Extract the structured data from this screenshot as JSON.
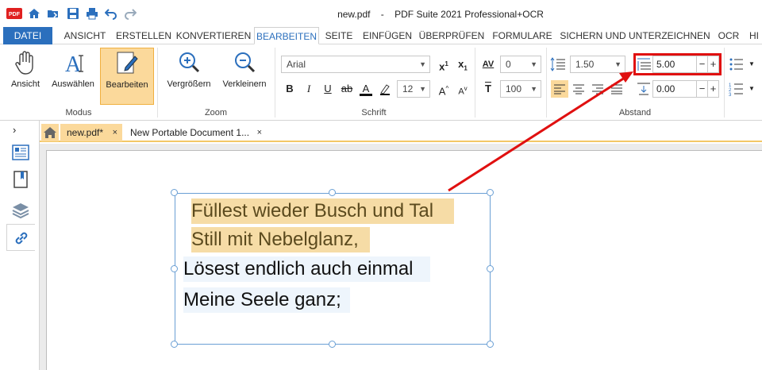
{
  "title": {
    "file": "new.pdf",
    "separator": "-",
    "app": "PDF Suite 2021  Professional+OCR"
  },
  "quick_access": [
    "pdf-logo-icon",
    "home-icon",
    "open-folder-icon",
    "save-icon",
    "print-icon",
    "undo-icon",
    "redo-icon"
  ],
  "menu": {
    "tabs": [
      "DATEI",
      "ANSICHT",
      "ERSTELLEN",
      "KONVERTIEREN",
      "BEARBEITEN",
      "SEITE",
      "EINFÜGEN",
      "ÜBERPRÜFEN",
      "FORMULARE",
      "SICHERN UND UNTERZEICHNEN",
      "OCR",
      "HI"
    ],
    "active": "BEARBEITEN"
  },
  "ribbon": {
    "modus": {
      "label": "Modus",
      "buttons": [
        "Ansicht",
        "Auswählen",
        "Bearbeiten"
      ]
    },
    "zoom": {
      "label": "Zoom",
      "buttons": [
        "Vergrößern",
        "Verkleinern"
      ]
    },
    "schrift": {
      "label": "Schrift",
      "font_name": "Arial",
      "font_size": "12",
      "char_spacing": "0",
      "char_scale": "100",
      "grow": "A",
      "shrink": "A"
    },
    "abstand": {
      "label": "Abstand",
      "line_spacing": "1.50",
      "paragraph_spacing": "5.00",
      "indent_value": "0.00"
    }
  },
  "doc_tabs": [
    {
      "label": "new.pdf*",
      "close": "×"
    },
    {
      "label": "New Portable Document 1...",
      "close": "×"
    }
  ],
  "document": {
    "lines": [
      "Füllest wieder Busch und Tal",
      "Still mit Nebelglanz,",
      "Lösest endlich auch einmal",
      "Meine Seele ganz;"
    ]
  },
  "colors": {
    "file_tab": "#2b6fbd",
    "highlight": "#fbd99b",
    "annotation_red": "#e01010",
    "selection_blue": "#6a9fd4"
  }
}
